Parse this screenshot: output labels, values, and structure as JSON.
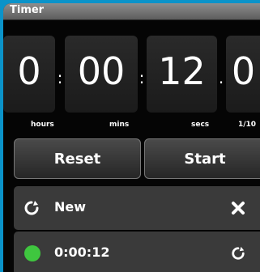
{
  "window": {
    "title": "Timer"
  },
  "display": {
    "hours": "0",
    "minutes": "00",
    "seconds": "12",
    "tenths": "0",
    "separators": [
      ":",
      ":",
      "."
    ],
    "unit_labels": {
      "hours": "hours",
      "mins": "mins",
      "secs": "secs",
      "tenths": "1/10"
    }
  },
  "buttons": {
    "reset": "Reset",
    "start": "Start"
  },
  "list": [
    {
      "label": "New",
      "left_icon": "refresh-icon",
      "right_icon": "close-icon"
    },
    {
      "label": "0:00:12",
      "left_icon": "green-status-dot-icon",
      "right_icon": "refresh-icon",
      "status_color": "#3fc63f"
    }
  ]
}
